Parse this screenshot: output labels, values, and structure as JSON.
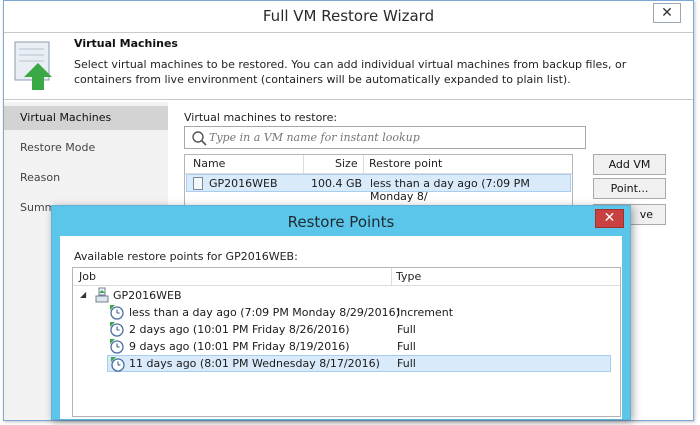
{
  "window": {
    "title": "Full VM Restore Wizard",
    "close_glyph": "✕"
  },
  "header": {
    "title": "Virtual Machines",
    "description": "Select virtual machines to be restored. You  can add individual virtual machines from backup files, or containers from live environment (containers will be automatically expanded to plain list).",
    "icon": "vm-restore-icon"
  },
  "steps": [
    {
      "label": "Virtual Machines",
      "active": true
    },
    {
      "label": "Restore Mode",
      "active": false
    },
    {
      "label": "Reason",
      "active": false
    },
    {
      "label": "Summary",
      "active": false
    }
  ],
  "vm_section": {
    "label": "Virtual machines to restore:",
    "search_placeholder": "Type in a VM name for instant lookup",
    "columns": [
      "Name",
      "Size",
      "Restore point"
    ],
    "rows": [
      {
        "name": "GP2016WEB",
        "size": "100.4 GB",
        "restore_point": "less than a day ago (7:09 PM Monday 8/"
      }
    ]
  },
  "buttons": {
    "add_vm": "Add VM",
    "point": "Point...",
    "remove_partial": "ve"
  },
  "dialog": {
    "title": "Restore Points",
    "close_glyph": "✕",
    "available_label": "Available restore points for GP2016WEB:",
    "columns": [
      "Job",
      "Type"
    ],
    "job_name": "GP2016WEB",
    "expand_glyph": "◢",
    "points": [
      {
        "label": "less than a day ago (7:09 PM Monday 8/29/2016)",
        "type": "Increment",
        "selected": false
      },
      {
        "label": "2 days ago (10:01 PM Friday 8/26/2016)",
        "type": "Full",
        "selected": false
      },
      {
        "label": "9 days ago (10:01 PM Friday 8/19/2016)",
        "type": "Full",
        "selected": false
      },
      {
        "label": "11 days ago (8:01 PM Wednesday 8/17/2016)",
        "type": "Full",
        "selected": true
      }
    ]
  },
  "colors": {
    "dialog_accent": "#5cc6ea",
    "selection": "#d9ebfb",
    "close_red": "#c84040",
    "restore_green": "#3aa845"
  }
}
